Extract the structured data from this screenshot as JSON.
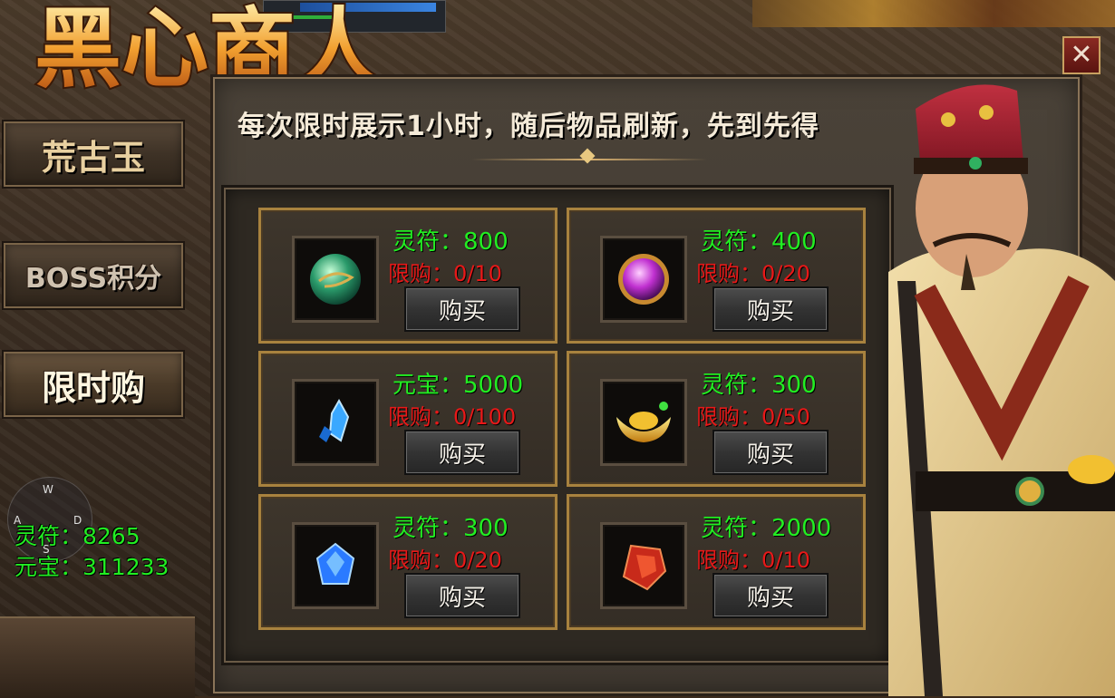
{
  "window": {
    "title": "黑心商人",
    "close_label": "✕"
  },
  "sidebar": {
    "items": [
      {
        "label": "荒古玉"
      },
      {
        "label": "BOSS积分"
      },
      {
        "label": "限时购",
        "active": true
      }
    ]
  },
  "notice": "每次限时展示1小时，随后物品刷新，先到先得",
  "shop": {
    "buy_label": "购买",
    "items": [
      {
        "price": "灵符：800",
        "limit": "限购：0/10",
        "icon": "green-jade-orb-icon"
      },
      {
        "price": "灵符：400",
        "limit": "限购：0/20",
        "icon": "purple-orb-icon"
      },
      {
        "price": "元宝：5000",
        "limit": "限购：0/100",
        "icon": "blue-crystal-shard-icon"
      },
      {
        "price": "灵符：300",
        "limit": "限购：0/50",
        "icon": "gold-ingot-icon"
      },
      {
        "price": "灵符：300",
        "limit": "限购：0/20",
        "icon": "blue-gem-icon"
      },
      {
        "price": "灵符：2000",
        "limit": "限购：0/10",
        "icon": "red-gem-icon"
      }
    ]
  },
  "currency": {
    "lingfu": "灵符：8265",
    "yuanbao": "元宝：311233"
  },
  "compass": {
    "n": "W",
    "w": "A",
    "e": "D",
    "s": "S"
  },
  "colors": {
    "price_green": "#22ee22",
    "limit_red": "#e81818",
    "card_border": "#a8823e"
  }
}
